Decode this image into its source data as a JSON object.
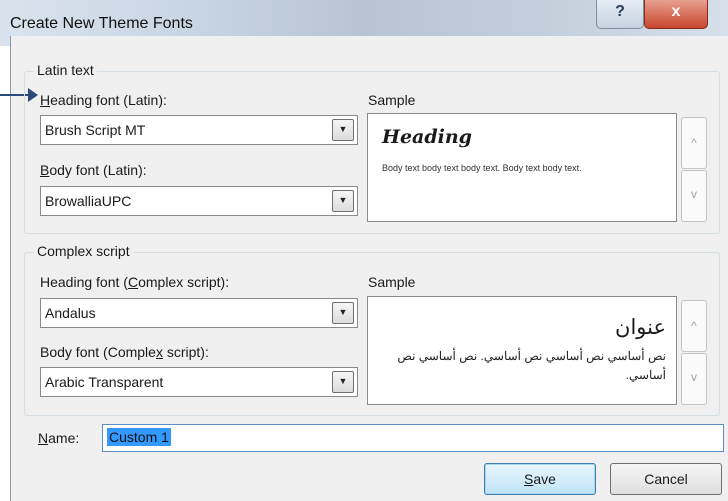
{
  "window": {
    "title": "Create New Theme Fonts",
    "help_glyph": "?",
    "close_glyph": "x"
  },
  "latin": {
    "group_title": "Latin text",
    "heading_label_u": "H",
    "heading_label_rest": "eading font (Latin):",
    "heading_value": "Brush Script MT",
    "body_label_u": "B",
    "body_label_rest": "ody font (Latin):",
    "body_value": "BrowalliaUPC",
    "sample_label": "Sample",
    "sample_heading": "Heading",
    "sample_body": "Body text body text body text. Body text body text."
  },
  "complex": {
    "group_title": "Complex script",
    "heading_label_a": "Heading font (",
    "heading_label_u": "C",
    "heading_label_b": "omplex script):",
    "heading_value": "Andalus",
    "body_label_a": "Body font (Comple",
    "body_label_u": "x",
    "body_label_b": " script):",
    "body_value": "Arabic Transparent",
    "sample_label": "Sample",
    "sample_heading": "عنوان",
    "sample_body": "نص أساسي نص أساسي نص أساسي. نص أساسي نص أساسي."
  },
  "name": {
    "label_u": "N",
    "label_rest": "ame:",
    "value": "Custom 1"
  },
  "buttons": {
    "save_u": "S",
    "save_rest": "ave",
    "cancel": "Cancel"
  },
  "glyphs": {
    "dropdown": "▼",
    "scroll_up": "^",
    "scroll_down": "v"
  }
}
